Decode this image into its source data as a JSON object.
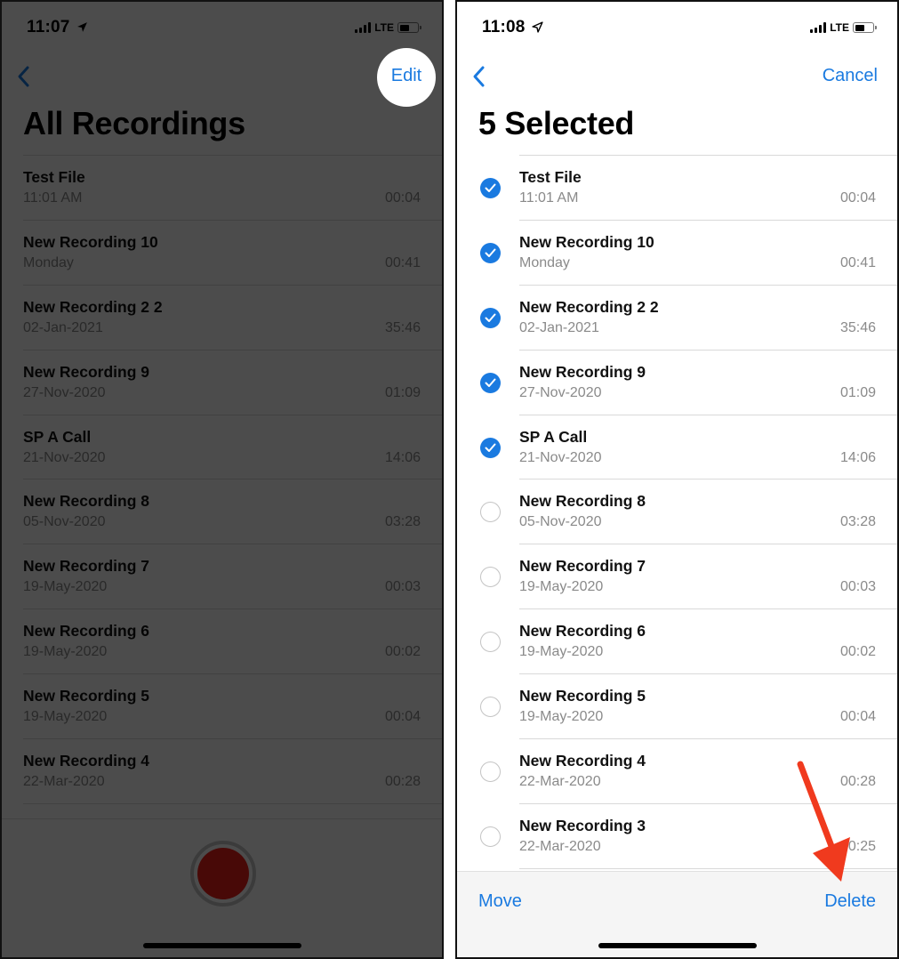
{
  "left_screen": {
    "status_bar": {
      "time": "11:07",
      "network": "LTE",
      "location_icon": "location-arrow-icon"
    },
    "nav": {
      "back_icon": "chevron-left-icon",
      "edit_label": "Edit"
    },
    "title": "All Recordings",
    "recordings": [
      {
        "title": "Test File",
        "date": "11:01 AM",
        "duration": "00:04"
      },
      {
        "title": "New Recording 10",
        "date": "Monday",
        "duration": "00:41"
      },
      {
        "title": "New Recording 2 2",
        "date": "02-Jan-2021",
        "duration": "35:46"
      },
      {
        "title": "New Recording 9",
        "date": "27-Nov-2020",
        "duration": "01:09"
      },
      {
        "title": "SP A Call",
        "date": "21-Nov-2020",
        "duration": "14:06"
      },
      {
        "title": "New Recording 8",
        "date": "05-Nov-2020",
        "duration": "03:28"
      },
      {
        "title": "New Recording 7",
        "date": "19-May-2020",
        "duration": "00:03"
      },
      {
        "title": "New Recording 6",
        "date": "19-May-2020",
        "duration": "00:02"
      },
      {
        "title": "New Recording 5",
        "date": "19-May-2020",
        "duration": "00:04"
      },
      {
        "title": "New Recording 4",
        "date": "22-Mar-2020",
        "duration": "00:28"
      }
    ],
    "record_button": "record-button",
    "overlay": "dimmed"
  },
  "right_screen": {
    "status_bar": {
      "time": "11:08",
      "network": "LTE",
      "location_icon": "location-arrow-outline-icon"
    },
    "nav": {
      "back_icon": "chevron-left-icon",
      "cancel_label": "Cancel"
    },
    "title": "5 Selected",
    "recordings": [
      {
        "title": "Test File",
        "date": "11:01 AM",
        "duration": "00:04",
        "selected": true
      },
      {
        "title": "New Recording 10",
        "date": "Monday",
        "duration": "00:41",
        "selected": true
      },
      {
        "title": "New Recording 2 2",
        "date": "02-Jan-2021",
        "duration": "35:46",
        "selected": true
      },
      {
        "title": "New Recording 9",
        "date": "27-Nov-2020",
        "duration": "01:09",
        "selected": true
      },
      {
        "title": "SP A Call",
        "date": "21-Nov-2020",
        "duration": "14:06",
        "selected": true
      },
      {
        "title": "New Recording 8",
        "date": "05-Nov-2020",
        "duration": "03:28",
        "selected": false
      },
      {
        "title": "New Recording 7",
        "date": "19-May-2020",
        "duration": "00:03",
        "selected": false
      },
      {
        "title": "New Recording 6",
        "date": "19-May-2020",
        "duration": "00:02",
        "selected": false
      },
      {
        "title": "New Recording 5",
        "date": "19-May-2020",
        "duration": "00:04",
        "selected": false
      },
      {
        "title": "New Recording 4",
        "date": "22-Mar-2020",
        "duration": "00:28",
        "selected": false
      },
      {
        "title": "New Recording 3",
        "date": "22-Mar-2020",
        "duration": "00:25",
        "selected": false
      }
    ],
    "toolbar": {
      "move_label": "Move",
      "delete_label": "Delete"
    },
    "annotation": "red-arrow-pointing-to-delete"
  },
  "colors": {
    "accent": "#1a7ae0",
    "record": "#f0201a",
    "annotation_arrow": "#f03a1e",
    "secondary_text": "#8a8a8a"
  }
}
